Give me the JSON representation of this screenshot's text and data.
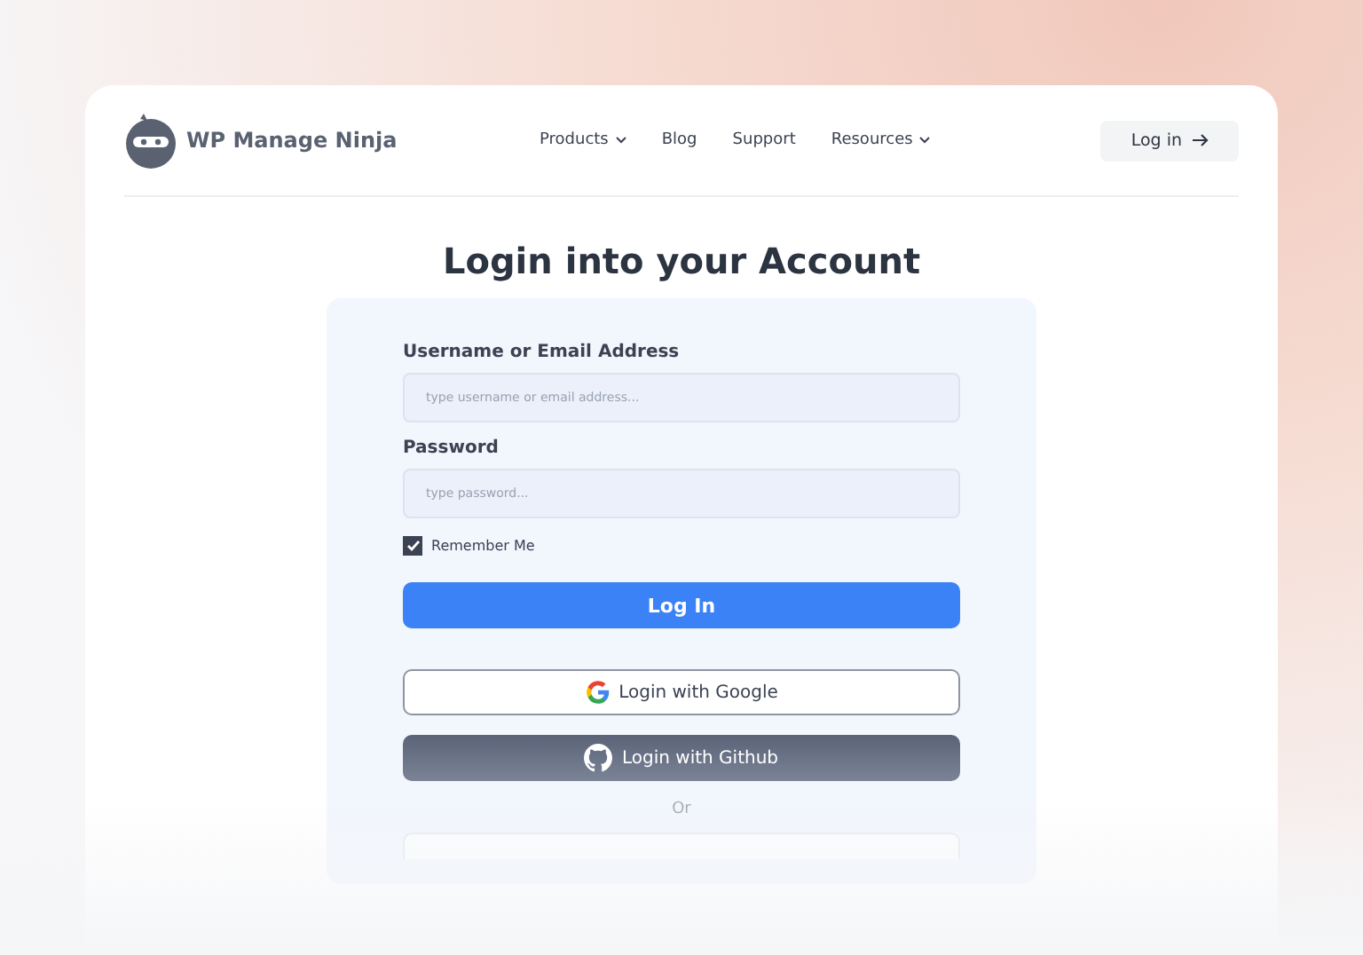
{
  "brand": {
    "name": "WP Manage Ninja"
  },
  "nav": [
    {
      "label": "Products",
      "has_dropdown": true
    },
    {
      "label": "Blog",
      "has_dropdown": false
    },
    {
      "label": "Support",
      "has_dropdown": false
    },
    {
      "label": "Resources",
      "has_dropdown": true
    }
  ],
  "header_button": {
    "label": "Log in"
  },
  "heading": "Login into your Account",
  "form": {
    "username": {
      "label": "Username or Email Address",
      "placeholder": "type username or email address..."
    },
    "password": {
      "label": "Password",
      "placeholder": "type password..."
    },
    "remember": {
      "label": "Remember Me",
      "checked": true
    },
    "submit": "Log In",
    "social": [
      {
        "kind": "google",
        "label": "Login with Google"
      },
      {
        "kind": "github",
        "label": "Login with Github"
      }
    ],
    "divider": "Or"
  }
}
